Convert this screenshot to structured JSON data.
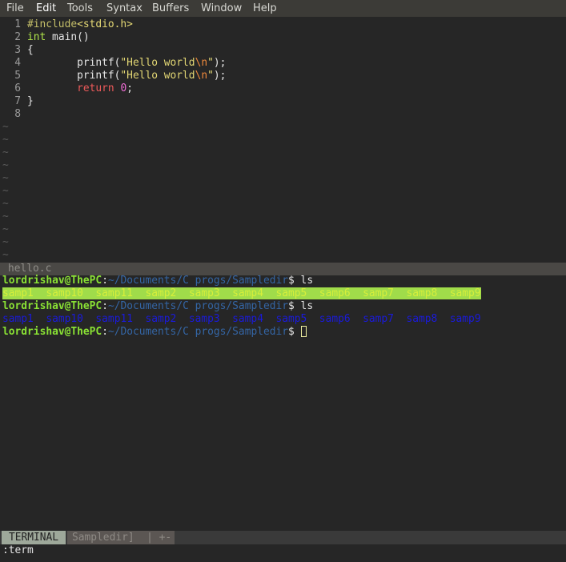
{
  "menubar": {
    "items": [
      "File",
      "Edit",
      "Tools",
      "Syntax",
      "Buffers",
      "Window",
      "Help"
    ],
    "active": "Edit"
  },
  "editor": {
    "line_numbers": [
      "1",
      "2",
      "3",
      "4",
      "5",
      "6",
      "7",
      "8"
    ],
    "code": {
      "l1": {
        "include": "#include",
        "header": "<stdio.h>"
      },
      "l2": {
        "type": "int",
        "rest": " main()"
      },
      "l3": {
        "text": "{"
      },
      "l4": {
        "indent": "        printf(",
        "q1": "\"Hello world",
        "esc": "\\n",
        "q2": "\"",
        "end": ");"
      },
      "l5": {
        "indent": "        printf(",
        "q1": "\"Hello world",
        "esc": "\\n",
        "q2": "\"",
        "end": ");"
      },
      "l6": {
        "indent": "        ",
        "kw": "return",
        "sp": " ",
        "num": "0",
        "end": ";"
      },
      "l7": {
        "text": "}"
      },
      "l8": {
        "text": ""
      }
    },
    "tilde": "~",
    "filename": "hello.c"
  },
  "terminal": {
    "user": "lordrishav@ThePC",
    "colon": ":",
    "path": "~/Documents/C progs/Sampledir",
    "prompt": "$",
    "cmd": " ls",
    "ls_output": "samp1  samp10  samp11  samp2  samp3  samp4  samp5  samp6  samp7  samp8  samp9"
  },
  "statusbar": {
    "active_tab": "TERMINAL",
    "inactive_tab": "Sampledir]  | +-"
  },
  "cmdline": ":term"
}
